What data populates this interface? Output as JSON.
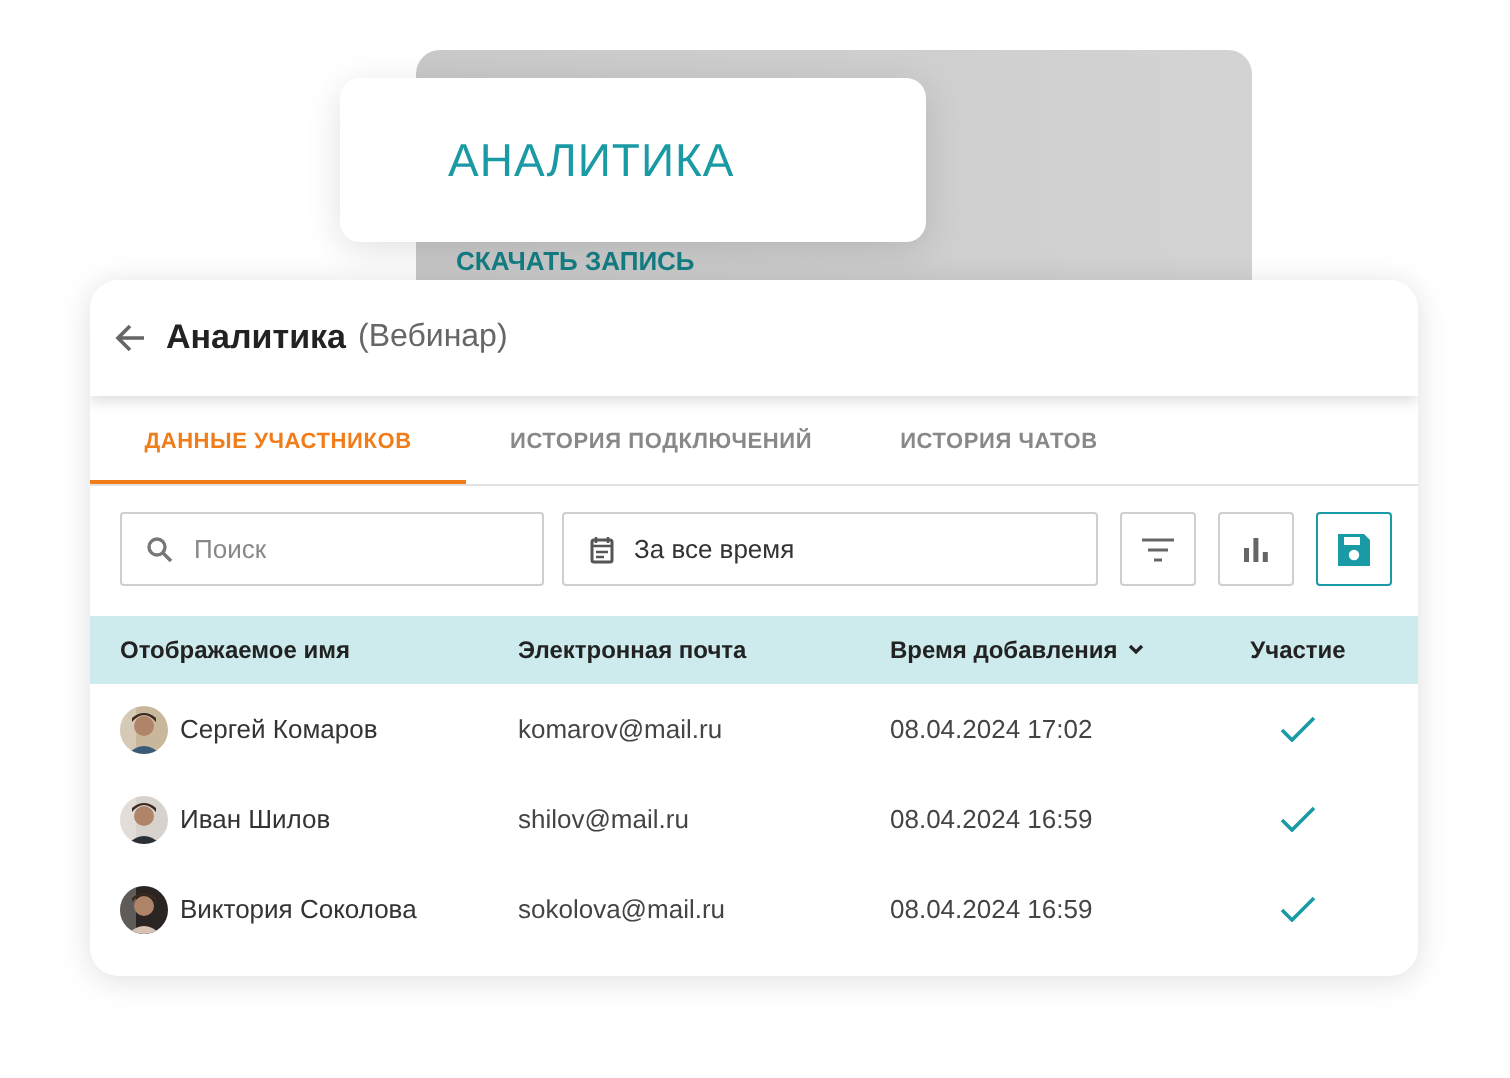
{
  "back_card": {
    "link": "СКАЧАТЬ ЗАПИСЬ"
  },
  "front_card": {
    "title": "АНАЛИТИКА"
  },
  "header": {
    "title": "Аналитика",
    "subtitle": "(Вебинар)"
  },
  "tabs": [
    {
      "label": "ДАННЫЕ УЧАСТНИКОВ",
      "selected": true
    },
    {
      "label": "ИСТОРИЯ ПОДКЛЮЧЕНИЙ",
      "selected": false
    },
    {
      "label": "ИСТОРИЯ ЧАТОВ",
      "selected": false
    }
  ],
  "search": {
    "placeholder": "Поиск"
  },
  "period": {
    "value": "За все время"
  },
  "toolbar_buttons": [
    {
      "kind": "filter",
      "active": false
    },
    {
      "kind": "chart",
      "active": false
    },
    {
      "kind": "save",
      "active": true
    }
  ],
  "table": {
    "columns": [
      {
        "label": "Отображаемое имя",
        "sorted": false
      },
      {
        "label": "Электронная почта",
        "sorted": false
      },
      {
        "label": "Время добавления",
        "sorted": true
      },
      {
        "label": "Участие",
        "sorted": false
      }
    ],
    "rows": [
      {
        "name": "Сергей Комаров",
        "email": "komarov@mail.ru",
        "added": "08.04.2024 17:02",
        "participated": true
      },
      {
        "name": "Иван Шилов",
        "email": "shilov@mail.ru",
        "added": "08.04.2024 16:59",
        "participated": true
      },
      {
        "name": "Виктория Соколова",
        "email": "sokolova@mail.ru",
        "added": "08.04.2024 16:59",
        "participated": true
      }
    ]
  }
}
